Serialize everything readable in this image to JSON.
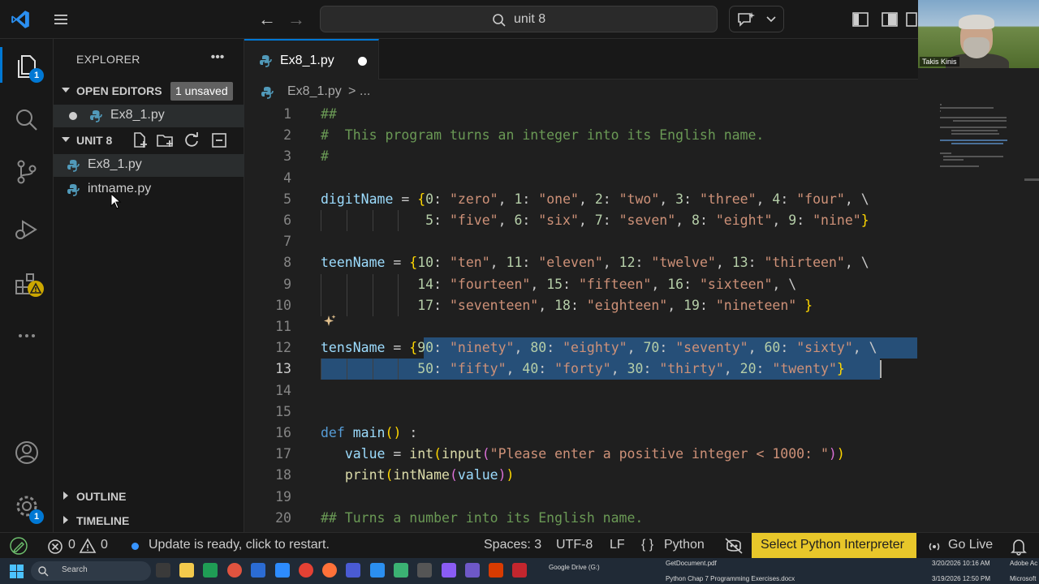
{
  "titlebar": {
    "search_text": "unit 8"
  },
  "webcam": {
    "name": "Takis Kinis"
  },
  "activity_bar": {
    "explorer_badge": "1",
    "accounts_badge": "1"
  },
  "sidebar": {
    "title": "EXPLORER",
    "open_editors_label": "OPEN EDITORS",
    "unsaved_badge": "1 unsaved",
    "open_editor_file": "Ex8_1.py",
    "folder_label": "UNIT 8",
    "files": [
      "Ex8_1.py",
      "intname.py"
    ],
    "outline_label": "OUTLINE",
    "timeline_label": "TIMELINE"
  },
  "editor": {
    "tab_label": "Ex8_1.py",
    "breadcrumb_file": "Ex8_1.py",
    "breadcrumb_sep": ">",
    "breadcrumb_more": "...",
    "line_numbers": [
      "1",
      "2",
      "3",
      "4",
      "5",
      "6",
      "7",
      "8",
      "9",
      "10",
      "11",
      "12",
      "13",
      "14",
      "15",
      "16",
      "17",
      "18",
      "19",
      "20"
    ],
    "lines": [
      "##",
      "#  This program turns an integer into its English name.",
      "#",
      "",
      "digitName = {0: \"zero\", 1: \"one\", 2: \"two\", 3: \"three\", 4: \"four\", \\",
      "             5: \"five\", 6: \"six\", 7: \"seven\", 8: \"eight\", 9: \"nine\"}",
      "",
      "teenName = {10: \"ten\", 11: \"eleven\", 12: \"twelve\", 13: \"thirteen\", \\",
      "            14: \"fourteen\", 15: \"fifteen\", 16: \"sixteen\", \\",
      "            17: \"seventeen\", 18: \"eighteen\", 19: \"nineteen\" }",
      "",
      "tensName = {90: \"ninety\", 80: \"eighty\", 70: \"seventy\", 60: \"sixty\", \\",
      "            50: \"fifty\", 40: \"forty\", 30: \"thirty\", 20: \"twenty\"}",
      "",
      "",
      "def main() :",
      "   value = int(input(\"Please enter a positive integer < 1000: \"))",
      "   print(intName(value))",
      "",
      "## Turns a number into its English name."
    ],
    "current_line": 13
  },
  "statusbar": {
    "errors": "0",
    "warnings": "0",
    "update_text": "Update is ready, click to restart.",
    "spaces": "Spaces: 3",
    "encoding": "UTF-8",
    "eol": "LF",
    "language": "Python",
    "interpreter": "Select Python Interpreter",
    "golive": "Go Live"
  },
  "taskbar": {
    "search_placeholder": "Search",
    "gdrive": "Google Drive (G:)",
    "doc1": "GetDocument.pdf",
    "doc2": "Python Chap 7 Programming Exercises.docx",
    "time1": "3/20/2026 10:16 AM",
    "time2": "3/19/2026 12:50 PM",
    "right1": "Adobe Ac",
    "right2": "Microsoft"
  },
  "colors": {
    "accent": "#0078d4",
    "interpreter_bg": "#e8c72a",
    "selection": "#264f78",
    "string": "#ce9178",
    "keyword": "#569cd6",
    "function": "#dcdcaa",
    "variable": "#9cdcfe",
    "number": "#b5cea8",
    "comment": "#6a9955"
  }
}
